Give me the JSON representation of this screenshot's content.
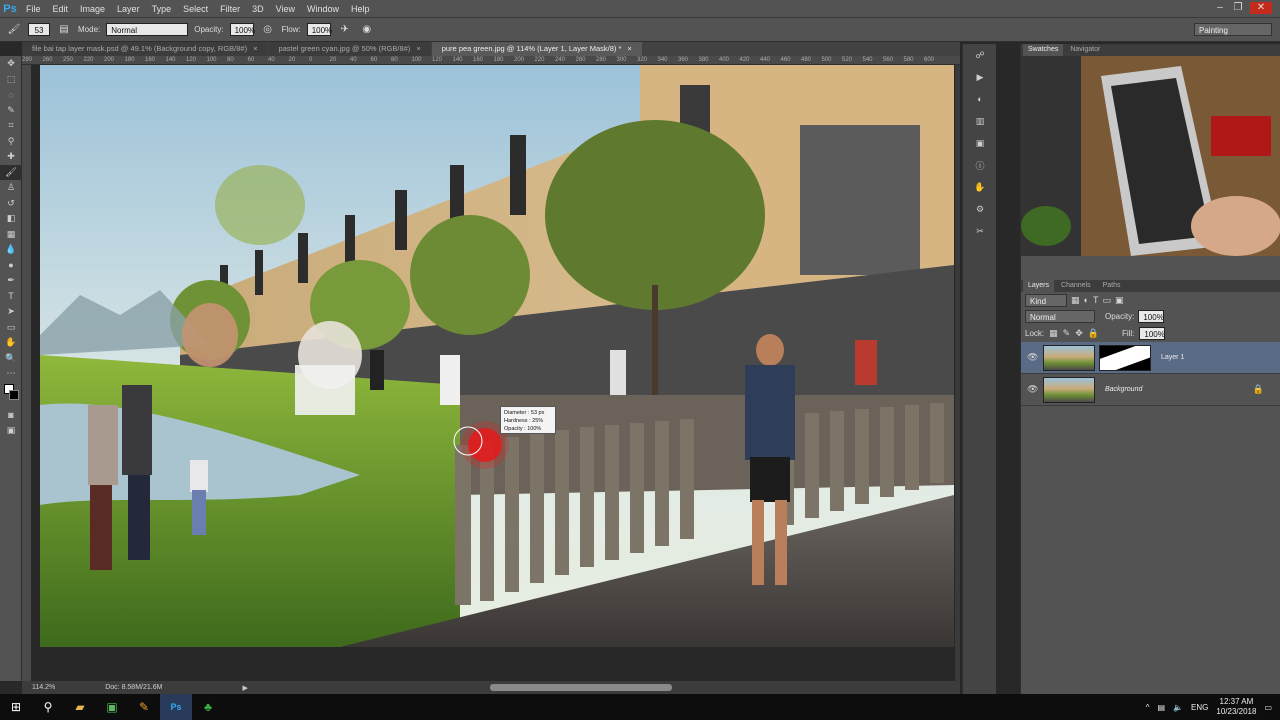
{
  "app": {
    "logo": "Ps"
  },
  "menu": [
    "File",
    "Edit",
    "Image",
    "Layer",
    "Type",
    "Select",
    "Filter",
    "3D",
    "View",
    "Window",
    "Help"
  ],
  "options": {
    "mode_label": "Mode:",
    "mode_value": "Normal",
    "opacity_label": "Opacity:",
    "opacity_value": "100%",
    "flow_label": "Flow:",
    "flow_value": "100%",
    "brush_size": "53",
    "workspace": "Painting"
  },
  "tabs": [
    {
      "label": "file bai tap layer mask.psd @ 49.1% (Background copy, RGB/8#)",
      "close": "×"
    },
    {
      "label": "pastel green cyan.jpg @ 50% (RGB/8#)",
      "close": "×"
    },
    {
      "label": "pure pea green.jpg @ 114% (Layer 1, Layer Mask/8) *",
      "close": "×"
    }
  ],
  "ruler_ticks": [
    "280",
    "260",
    "250",
    "220",
    "200",
    "180",
    "160",
    "140",
    "120",
    "100",
    "80",
    "60",
    "40",
    "20",
    "0",
    "20",
    "40",
    "60",
    "80",
    "100",
    "120",
    "140",
    "160",
    "180",
    "200",
    "220",
    "240",
    "260",
    "280",
    "300",
    "320",
    "340",
    "360",
    "380",
    "400",
    "420",
    "440",
    "460",
    "480",
    "500",
    "520",
    "540",
    "560",
    "580",
    "600"
  ],
  "brush_tip": {
    "diameter_label": "Diameter :",
    "diameter_value": "53 px",
    "hardness_label": "Hardness :",
    "hardness_value": "25%",
    "opacity_label": "Opacity :",
    "opacity_value": "100%"
  },
  "status": {
    "zoom": "114.2%",
    "doc": "Doc: 8.58M/21.6M"
  },
  "panels": {
    "top_tabs": [
      "Swatches",
      "Navigator"
    ],
    "layers_tabs": [
      "Layers",
      "Channels",
      "Paths"
    ],
    "filter_kind": "Kind",
    "blend_mode": "Normal",
    "opacity_label": "Opacity:",
    "opacity_value": "100%",
    "lock_label": "Lock:",
    "fill_label": "Fill:",
    "fill_value": "100%",
    "layers": [
      {
        "name": "Layer 1",
        "selected": true
      },
      {
        "name": "Background",
        "selected": false
      }
    ]
  },
  "taskbar": {
    "time": "12:37 AM",
    "date": "10/23/2018",
    "lang": "ENG"
  },
  "colors": {
    "accent": "#36a9f0",
    "panel": "#535353",
    "dark": "#282828",
    "selected_layer": "#5a6c85"
  }
}
